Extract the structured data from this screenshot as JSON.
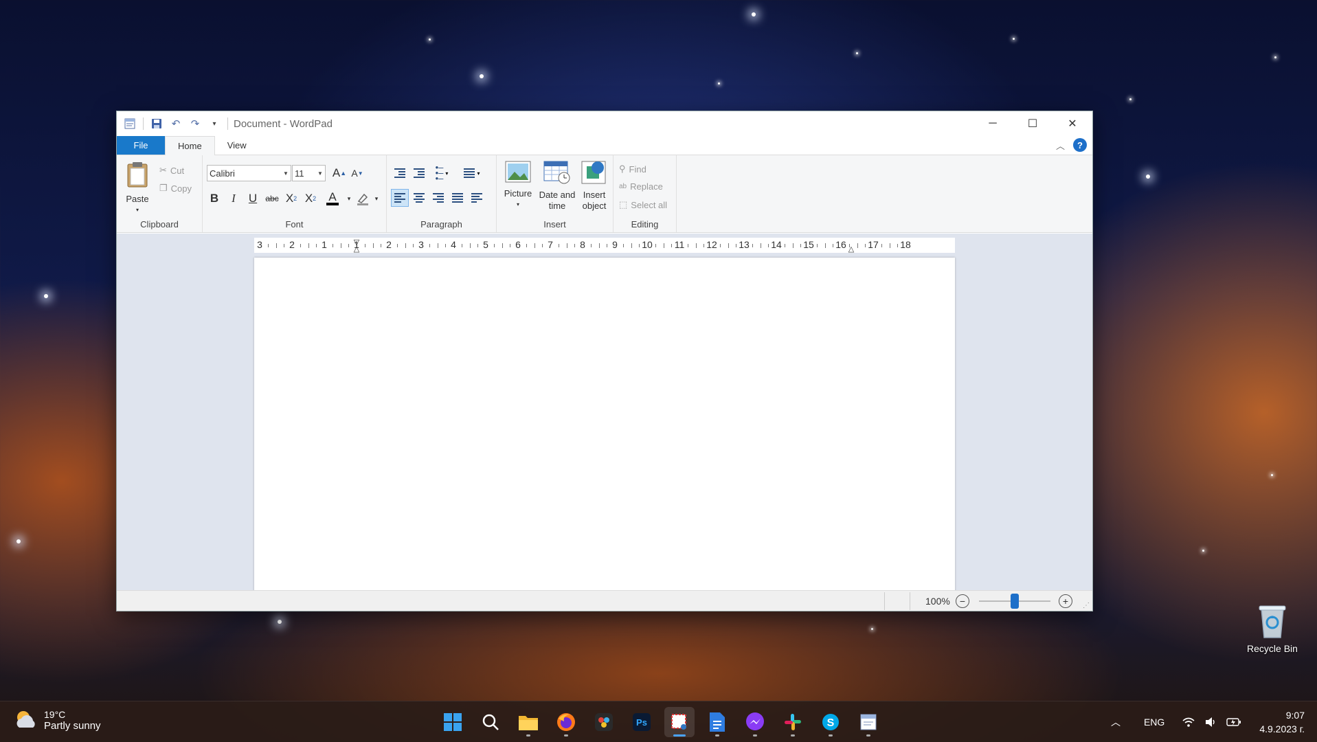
{
  "window": {
    "title": "Document - WordPad",
    "controls": {
      "minimize": "─",
      "maximize": "☐",
      "close": "✕"
    }
  },
  "tabs": {
    "file": "File",
    "home": "Home",
    "view": "View"
  },
  "ribbon": {
    "clipboard": {
      "label": "Clipboard",
      "paste": "Paste",
      "cut": "Cut",
      "copy": "Copy"
    },
    "font": {
      "label": "Font",
      "family": "Calibri",
      "size": "11",
      "grow": "A",
      "shrink": "A",
      "bold": "B",
      "italic": "I",
      "underline": "U",
      "strikethrough": "abc",
      "subscript": "X",
      "superscript": "X",
      "font_color": "A"
    },
    "paragraph": {
      "label": "Paragraph"
    },
    "insert": {
      "label": "Insert",
      "picture": "Picture",
      "datetime_1": "Date and",
      "datetime_2": "time",
      "object_1": "Insert",
      "object_2": "object"
    },
    "editing": {
      "label": "Editing",
      "find": "Find",
      "replace": "Replace",
      "select_all": "Select all"
    }
  },
  "ruler": {
    "labels": [
      "3",
      "2",
      "1",
      "1",
      "2",
      "3",
      "4",
      "5",
      "6",
      "7",
      "8",
      "9",
      "10",
      "11",
      "12",
      "13",
      "14",
      "15",
      "16",
      "17",
      "18"
    ]
  },
  "status": {
    "zoom": "100%",
    "zoom_out": "−",
    "zoom_in": "+",
    "zoom_level": 0.5
  },
  "desktop": {
    "recycle_bin": "Recycle Bin"
  },
  "taskbar": {
    "weather_temp": "19°C",
    "weather_desc": "Partly sunny",
    "language": "ENG",
    "time": "9:07",
    "date": "4.9.2023 г.",
    "apps": [
      "start-icon",
      "search-icon",
      "file-explorer-icon",
      "firefox-icon",
      "davinci-resolve-icon",
      "photoshop-icon",
      "snipping-tool-icon",
      "google-docs-icon",
      "messenger-icon",
      "slack-icon",
      "skype-icon",
      "wordpad-icon"
    ]
  },
  "colors": {
    "accent": "#1979ca",
    "file_tab": "#1979ca",
    "workspace": "#dfe4ee"
  }
}
